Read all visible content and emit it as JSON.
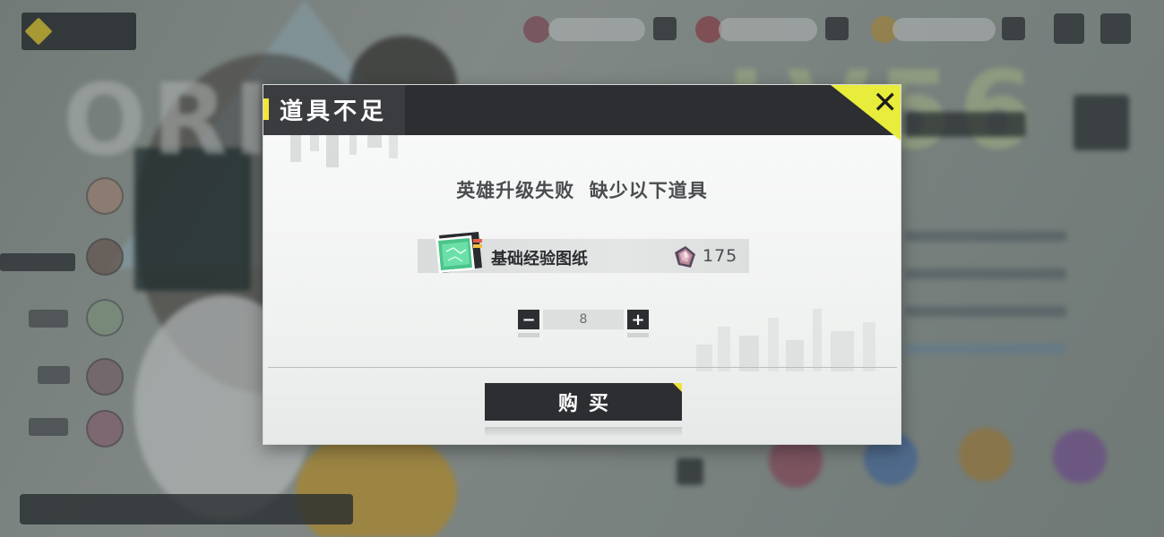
{
  "modal": {
    "title": "道具不足",
    "close_symbol": "✕",
    "message": "英雄升级失败  缺少以下道具",
    "item": {
      "name": "基础经验图纸",
      "icon": "blueprint-card-icon",
      "cost_icon": "crystal-icon",
      "cost": "175"
    },
    "quantity": {
      "minus": "−",
      "value": "8",
      "plus": "+"
    },
    "buy_label": "购买"
  },
  "colors": {
    "accent_yellow": "#f4e53a",
    "panel_dark": "#2d2e31",
    "panel_light": "#f4f5f5"
  }
}
